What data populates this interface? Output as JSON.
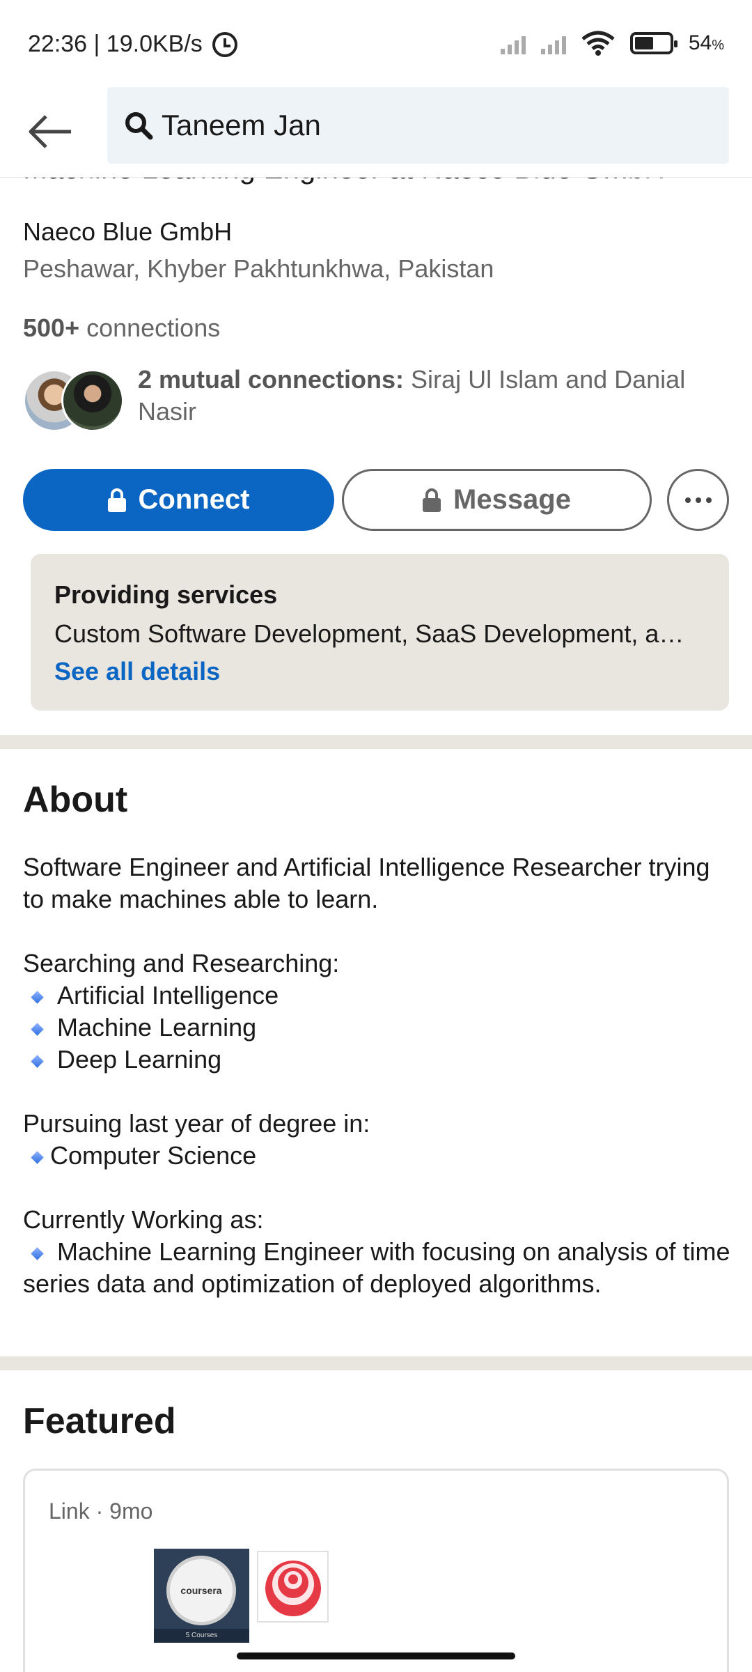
{
  "status_bar": {
    "time_speed": "22:36 | 19.0KB/s",
    "battery_percent": "54",
    "battery_percent_sign": "%",
    "battery_level": 0.54
  },
  "search": {
    "query": "Taneem Jan"
  },
  "profile": {
    "headline_partial": "Machine Learning Engineer at Naeco Blue GmbH",
    "company": "Naeco Blue GmbH",
    "location": "Peshawar, Khyber Pakhtunkhwa, Pakistan",
    "connections_count": "500+",
    "connections_label": " connections",
    "mutual_bold": "2 mutual connections:",
    "mutual_names": " Siraj Ul Islam and Danial Nasir"
  },
  "actions": {
    "connect_label": "Connect",
    "message_label": "Message"
  },
  "services": {
    "title": "Providing services",
    "list": "Custom Software Development, SaaS Development, a…",
    "link": "See all details"
  },
  "about": {
    "title": "About",
    "intro": "Software Engineer and Artificial Intelligence Researcher trying to make machines able to learn.",
    "searching_heading": "Searching and Researching:",
    "searching_items": [
      "Artificial Intelligence",
      "Machine Learning",
      "Deep Learning"
    ],
    "degree_heading": "Pursuing last year of degree in:",
    "degree_item": "Computer Science",
    "working_heading": "Currently Working as:",
    "working_item": "Machine Learning Engineer with focusing on analysis of time series data and optimization of deployed algorithms."
  },
  "featured": {
    "title": "Featured",
    "card_meta": "Link · 9mo",
    "coursera_label": "coursera",
    "coursera_footer": "5 Courses"
  }
}
